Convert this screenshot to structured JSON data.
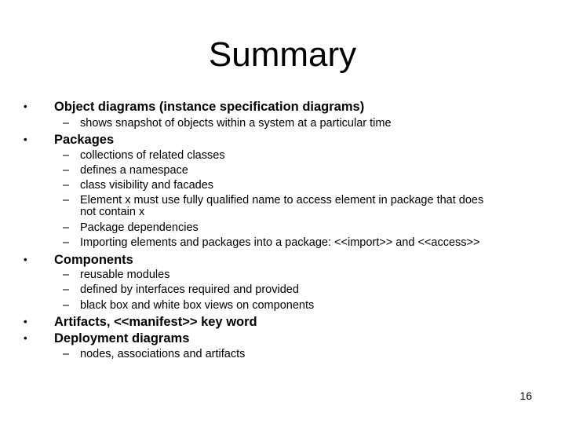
{
  "slide": {
    "title": "Summary",
    "page_number": "16",
    "bullet_glyph": "•",
    "dash_glyph": "–",
    "sections": [
      {
        "heading": "Object diagrams (instance specification diagrams)",
        "items": [
          "shows snapshot of objects within a system at a particular time"
        ]
      },
      {
        "heading": "Packages",
        "items": [
          "collections of related classes",
          "defines a namespace",
          "class visibility and facades",
          "Element x must use fully qualified name to access element in package that does",
          "not contain x",
          "Package dependencies",
          "Importing elements and packages into a package: <<import>> and <<access>>"
        ]
      },
      {
        "heading": "Components",
        "items": [
          "reusable modules",
          "defined by interfaces required and provided",
          "black box and white box views on components"
        ]
      },
      {
        "heading": "Artifacts, <<manifest>> key word",
        "items": []
      },
      {
        "heading": "Deployment diagrams",
        "items": [
          "nodes, associations and artifacts"
        ]
      }
    ]
  }
}
